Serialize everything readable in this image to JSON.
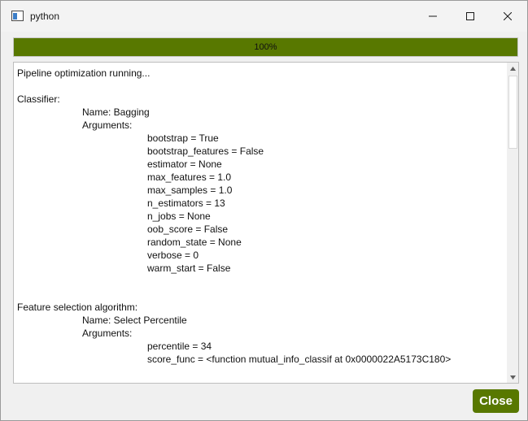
{
  "window": {
    "title": "python",
    "icon": "app-window-icon",
    "controls": [
      "minimize-icon",
      "maximize-icon",
      "close-icon"
    ]
  },
  "progress": {
    "value_percent": 100,
    "label": "100%",
    "color": "#587800"
  },
  "log": {
    "lines": [
      {
        "indent": 0,
        "text": "Pipeline optimization running..."
      },
      {
        "indent": 0,
        "text": ""
      },
      {
        "indent": 0,
        "text": "Classifier:"
      },
      {
        "indent": 1,
        "text": "Name: Bagging"
      },
      {
        "indent": 1,
        "text": "Arguments:"
      },
      {
        "indent": 2,
        "text": "bootstrap = True"
      },
      {
        "indent": 2,
        "text": "bootstrap_features = False"
      },
      {
        "indent": 2,
        "text": "estimator = None"
      },
      {
        "indent": 2,
        "text": "max_features = 1.0"
      },
      {
        "indent": 2,
        "text": "max_samples = 1.0"
      },
      {
        "indent": 2,
        "text": "n_estimators = 13"
      },
      {
        "indent": 2,
        "text": "n_jobs = None"
      },
      {
        "indent": 2,
        "text": "oob_score = False"
      },
      {
        "indent": 2,
        "text": "random_state = None"
      },
      {
        "indent": 2,
        "text": "verbose = 0"
      },
      {
        "indent": 2,
        "text": "warm_start = False"
      },
      {
        "indent": 0,
        "text": ""
      },
      {
        "indent": 0,
        "text": ""
      },
      {
        "indent": 0,
        "text": "Feature selection algorithm:"
      },
      {
        "indent": 1,
        "text": "Name: Select Percentile"
      },
      {
        "indent": 1,
        "text": "Arguments:"
      },
      {
        "indent": 2,
        "text": "percentile = 34"
      },
      {
        "indent": 2,
        "text": "score_func = <function mutual_info_classif at 0x0000022A5173C180>"
      }
    ]
  },
  "actions": {
    "close_label": "Close",
    "accent_color": "#587800"
  }
}
